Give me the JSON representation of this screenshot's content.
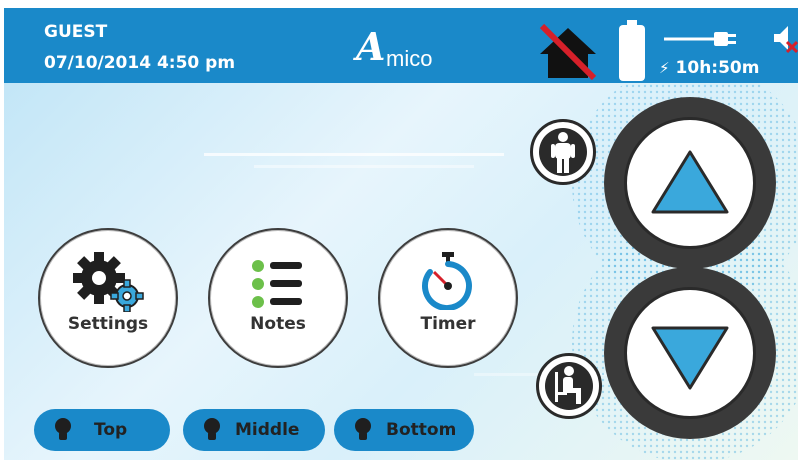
{
  "header": {
    "user": "GUEST",
    "datetime": "07/10/2014 4:50 pm",
    "logo": "Amico",
    "charge_time": "10h:50m",
    "icons": [
      "home-unavailable-icon",
      "battery-icon",
      "plug-icon",
      "charging-bolt-icon",
      "speaker-muted-icon"
    ]
  },
  "buttons": {
    "settings": "Settings",
    "notes": "Notes",
    "timer": "Timer"
  },
  "lights": {
    "top": "Top",
    "middle": "Middle",
    "bottom": "Bottom"
  },
  "controls": {
    "up_icon": "arrow-up-icon",
    "down_icon": "arrow-down-icon",
    "stand_icon": "standing-person-icon",
    "sit_icon": "sitting-person-icon"
  },
  "colors": {
    "header_bg": "#1a89c9",
    "accent": "#3aa8dc",
    "dark": "#2a2a2a",
    "notes_green": "#6cc04a",
    "mute_red": "#d6202a"
  }
}
